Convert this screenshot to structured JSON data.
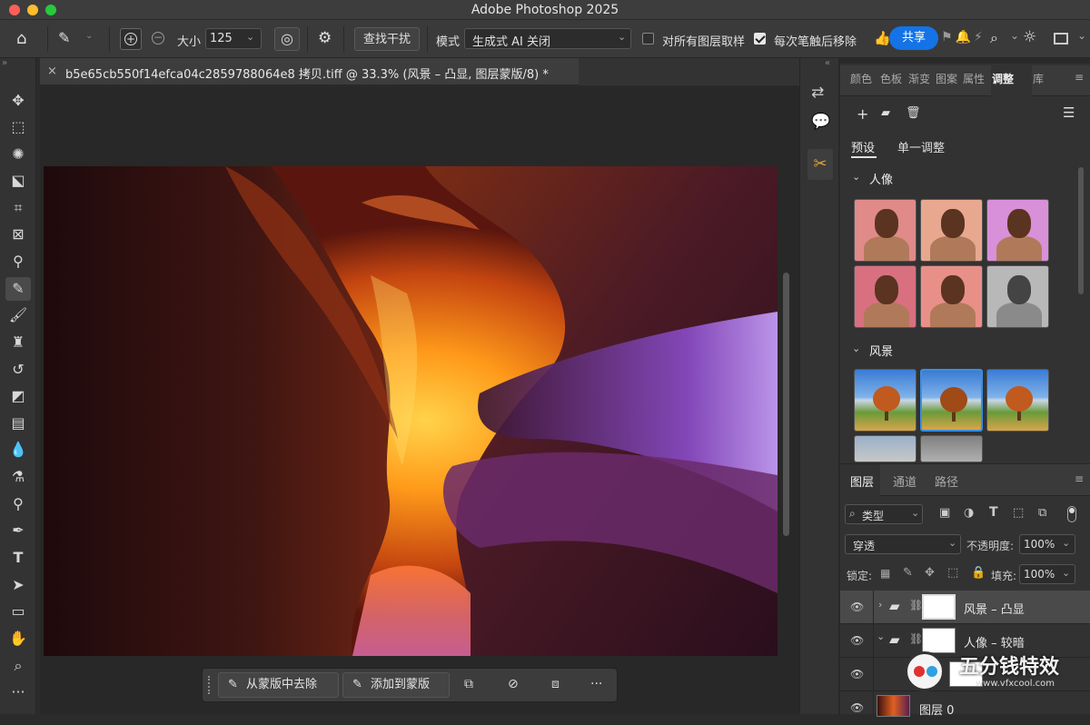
{
  "window": {
    "title": "Adobe Photoshop 2025"
  },
  "optionsbar": {
    "size_label": "大小",
    "size_value": "125",
    "find_distractions_label": "查找干扰",
    "mode_label": "模式",
    "mode_value": "生成式 AI 关闭",
    "sample_all_layers_label": "对所有图层取样",
    "remove_after_stroke_label": "每次笔触后移除",
    "share_label": "共享"
  },
  "document": {
    "tab_title": "b5e65cb550f14efca04c2859788064e8 拷贝.tiff @ 33.3% (风景 – 凸显, 图层蒙版/8) *",
    "close_glyph": "×"
  },
  "maskbar": {
    "subtract_label": "从蒙版中去除",
    "add_label": "添加到蒙版",
    "more_label": "···"
  },
  "right_panel": {
    "tabs": [
      "颜色",
      "色板",
      "渐变",
      "图案",
      "属性",
      "调整",
      "库"
    ],
    "active_tab": "调整",
    "subtabs": [
      "预设",
      "单一调整"
    ],
    "sections": [
      {
        "title": "人像"
      },
      {
        "title": "风景"
      }
    ],
    "layers_tabs": [
      "图层",
      "通道",
      "路径"
    ],
    "filter_label": "类型",
    "blend_mode": "穿透",
    "opacity_label": "不透明度:",
    "opacity_value": "100%",
    "lock_label": "锁定:",
    "fill_label": "填充:",
    "fill_value": "100%",
    "layers": [
      {
        "name": "风景 – 凸显"
      },
      {
        "name": "人像 – 较暗"
      },
      {
        "name": ""
      },
      {
        "name": "图层 0"
      }
    ]
  },
  "watermark": {
    "cn": "五分钱特效",
    "url": "www.vfxcool.com"
  },
  "colors": {
    "accent": "#1473e6",
    "panel_bg": "#323232",
    "canvas_bg": "#282828"
  }
}
